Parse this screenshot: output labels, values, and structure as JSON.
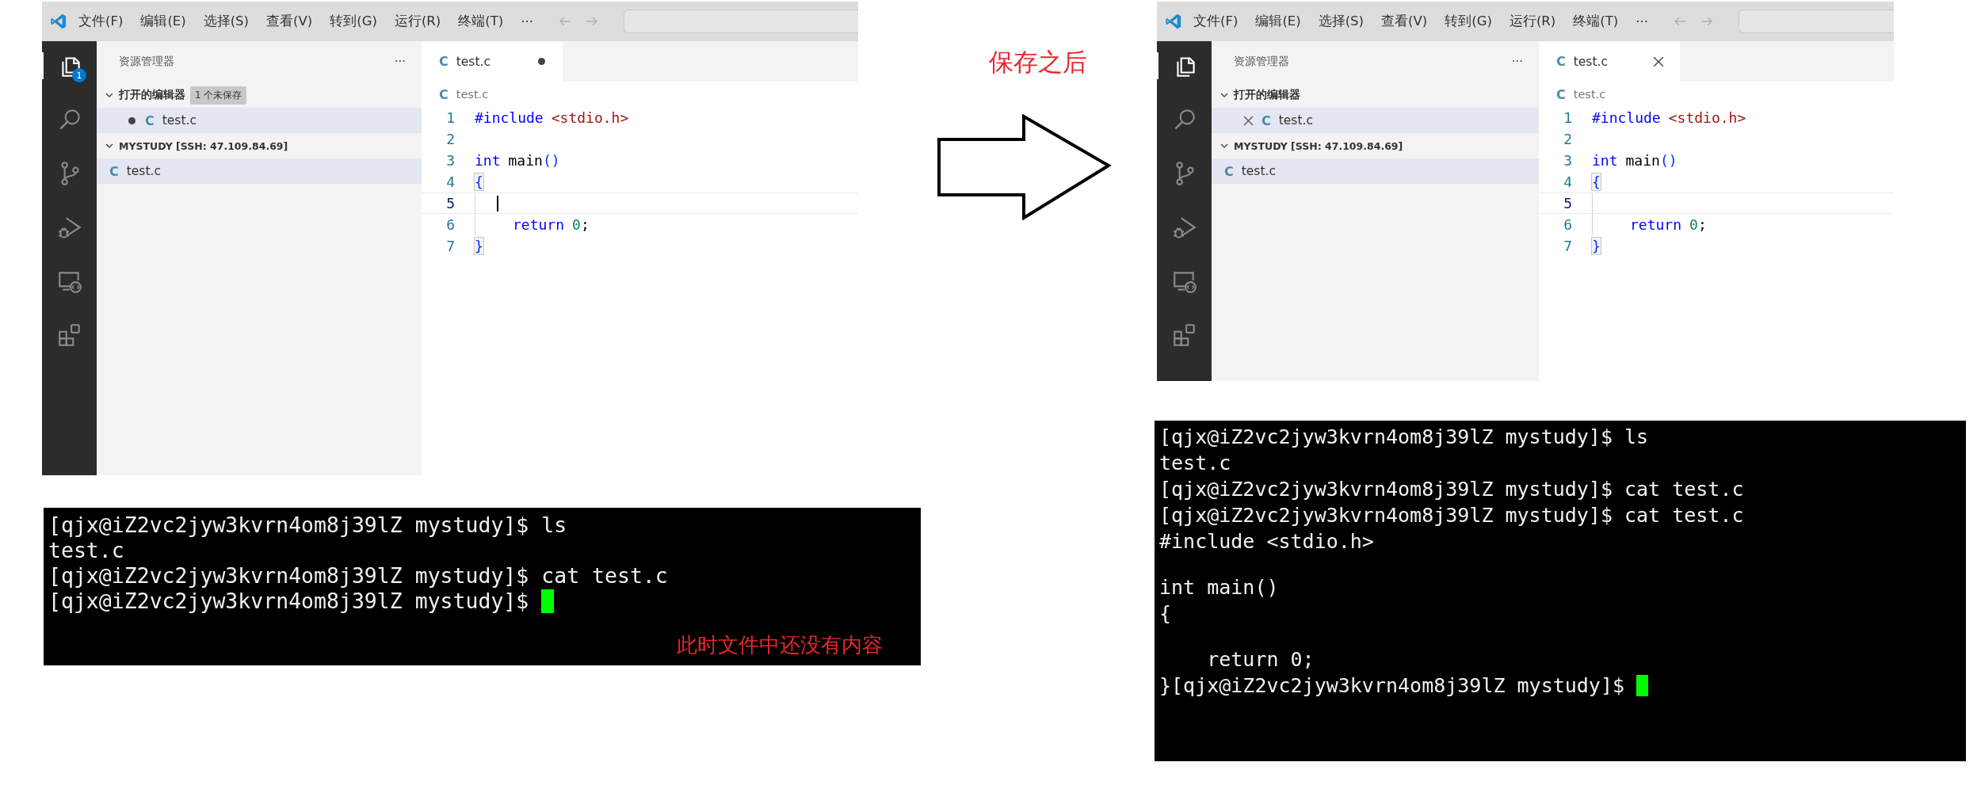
{
  "before": {
    "editor_window": {
      "menu": [
        "文件(F)",
        "编辑(E)",
        "选择(S)",
        "查看(V)",
        "转到(G)",
        "运行(R)",
        "终端(T)"
      ],
      "menu_more": "···",
      "explorer_badge": "1",
      "explorer_title": "资源管理器",
      "explorer_more": "···",
      "open_editors": {
        "label": "打开的编辑器",
        "expanded": true,
        "badge": "1 个未保存",
        "items": [
          {
            "icon": "C",
            "name": "test.c",
            "dirty": true,
            "selected": true
          }
        ]
      },
      "folder": {
        "label": "MYSTUDY [SSH: 47.109.84.69]",
        "expanded": true,
        "items": [
          {
            "icon": "C",
            "name": "test.c",
            "selected": true
          }
        ]
      },
      "tabs": [
        {
          "icon": "C",
          "name": "test.c",
          "dirty": true,
          "selected": true
        }
      ],
      "breadcrumb": {
        "icon": "C",
        "name": "test.c"
      },
      "code": [
        {
          "number": "1",
          "current": false,
          "indented": false,
          "cursor": false,
          "tokens": [
            {
              "t": "#include",
              "kind": "keyword"
            },
            {
              "t": "<stdio.h>",
              "kind": "string"
            }
          ]
        },
        {
          "number": "2",
          "current": false,
          "indented": false,
          "cursor": false
        },
        {
          "number": "3",
          "current": false,
          "indented": false,
          "cursor": false,
          "tokens": [
            {
              "t": "int",
              "kind": "keyword"
            },
            {
              "t": "main",
              "kind": "plain"
            },
            {
              "t": "()",
              "kind": "paren",
              "joined": true
            }
          ]
        },
        {
          "number": "4",
          "current": false,
          "indented": false,
          "cursor": false,
          "tokens": [
            {
              "t": "{",
              "kind": "brace"
            }
          ]
        },
        {
          "number": "5",
          "current": true,
          "indented": true,
          "cursor": true
        },
        {
          "number": "6",
          "current": false,
          "indented": true,
          "cursor": false,
          "tokens": [
            {
              "t": "return",
              "kind": "keyword"
            },
            {
              "t": "0",
              "kind": "number"
            },
            {
              "t": ";",
              "kind": "plain",
              "joined": true
            }
          ]
        },
        {
          "number": "7",
          "current": false,
          "indented": false,
          "cursor": false,
          "tokens": [
            {
              "t": "}",
              "kind": "brace"
            }
          ]
        }
      ]
    },
    "terminal": {
      "lines": [
        {
          "kind": "output",
          "text": "[qjx@iZ2vc2jyw3kvrn4om8j39lZ mystudy]$ ls",
          "cursor": false
        },
        {
          "kind": "output",
          "text": "test.c",
          "cursor": false
        },
        {
          "kind": "output",
          "text": "[qjx@iZ2vc2jyw3kvrn4om8j39lZ mystudy]$ cat test.c",
          "cursor": false
        },
        {
          "kind": "output",
          "text": "[qjx@iZ2vc2jyw3kvrn4om8j39lZ mystudy]$ ",
          "cursor": true
        }
      ]
    },
    "note": "此时文件中还没有内容"
  },
  "arrow_label": "保存之后",
  "after": {
    "editor_window": {
      "menu": [
        "文件(F)",
        "编辑(E)",
        "选择(S)",
        "查看(V)",
        "转到(G)",
        "运行(R)",
        "终端(T)"
      ],
      "menu_more": "···",
      "explorer_title": "资源管理器",
      "explorer_more": "···",
      "open_editors": {
        "label": "打开的编辑器",
        "expanded": true,
        "items": [
          {
            "icon": "C",
            "name": "test.c",
            "dirty": false,
            "selected": true
          }
        ]
      },
      "folder": {
        "label": "MYSTUDY [SSH: 47.109.84.69]",
        "expanded": true,
        "items": [
          {
            "icon": "C",
            "name": "test.c",
            "selected": true
          }
        ]
      },
      "tabs": [
        {
          "icon": "C",
          "name": "test.c",
          "dirty": false,
          "selected": true
        }
      ],
      "breadcrumb": {
        "icon": "C",
        "name": "test.c"
      },
      "code": [
        {
          "number": "1",
          "current": false,
          "indented": false,
          "cursor": false,
          "tokens": [
            {
              "t": "#include",
              "kind": "keyword"
            },
            {
              "t": "<stdio.h>",
              "kind": "string"
            }
          ]
        },
        {
          "number": "2",
          "current": false,
          "indented": false,
          "cursor": false
        },
        {
          "number": "3",
          "current": false,
          "indented": false,
          "cursor": false,
          "tokens": [
            {
              "t": "int",
              "kind": "keyword"
            },
            {
              "t": "main",
              "kind": "plain"
            },
            {
              "t": "()",
              "kind": "paren",
              "joined": true
            }
          ]
        },
        {
          "number": "4",
          "current": false,
          "indented": false,
          "cursor": false,
          "tokens": [
            {
              "t": "{",
              "kind": "brace"
            }
          ]
        },
        {
          "number": "5",
          "current": true,
          "indented": true,
          "cursor": false
        },
        {
          "number": "6",
          "current": false,
          "indented": true,
          "cursor": false,
          "tokens": [
            {
              "t": "return",
              "kind": "keyword"
            },
            {
              "t": "0",
              "kind": "number"
            },
            {
              "t": ";",
              "kind": "plain",
              "joined": true
            }
          ]
        },
        {
          "number": "7",
          "current": false,
          "indented": false,
          "cursor": false,
          "tokens": [
            {
              "t": "}",
              "kind": "brace"
            }
          ]
        }
      ]
    },
    "terminal": {
      "lines": [
        {
          "kind": "output",
          "text": "[qjx@iZ2vc2jyw3kvrn4om8j39lZ mystudy]$ ls",
          "cursor": false
        },
        {
          "kind": "output",
          "text": "test.c",
          "cursor": false
        },
        {
          "kind": "output",
          "text": "[qjx@iZ2vc2jyw3kvrn4om8j39lZ mystudy]$ cat test.c",
          "cursor": false
        },
        {
          "kind": "output",
          "text": "[qjx@iZ2vc2jyw3kvrn4om8j39lZ mystudy]$ cat test.c",
          "cursor": false
        },
        {
          "kind": "output",
          "text": "#include <stdio.h>",
          "cursor": false
        },
        {
          "kind": "blank"
        },
        {
          "kind": "output",
          "text": "int main()",
          "cursor": false
        },
        {
          "kind": "output",
          "text": "{",
          "cursor": false
        },
        {
          "kind": "blank"
        },
        {
          "kind": "output",
          "text": "    return 0;",
          "cursor": false
        },
        {
          "kind": "output",
          "text": "}[qjx@iZ2vc2jyw3kvrn4om8j39lZ mystudy]$ ",
          "cursor": true
        }
      ]
    }
  }
}
